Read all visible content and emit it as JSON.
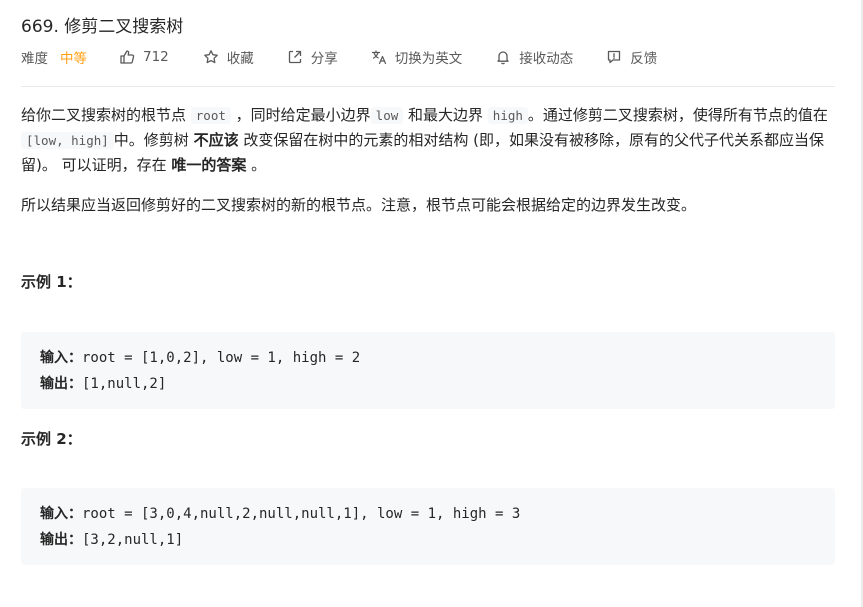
{
  "problem": {
    "title": "669. 修剪二叉搜索树",
    "difficulty_label": "难度",
    "difficulty": "中等",
    "likes": "712",
    "collect_label": "收藏",
    "share_label": "分享",
    "switch_lang_label": "切换为英文",
    "notify_label": "接收动态",
    "feedback_label": "反馈"
  },
  "description": {
    "p1": {
      "t1": "给你二叉搜索树的根节点 ",
      "c1": "root",
      "t2": " ，同时给定最小边界",
      "c2": "low",
      "t3": " 和最大边界 ",
      "c3": "high",
      "t4": "。通过修剪二叉搜索树，使得所有节点的值在",
      "c4": "[low, high]",
      "t5": "中。修剪树 ",
      "b1": "不应该",
      "t6": " 改变保留在树中的元素的相对结构 (即，如果没有被移除，原有的父代子代关系都应当保留)。 可以证明，存在 ",
      "b2": "唯一的答案",
      "t7": " 。"
    },
    "p2": "所以结果应当返回修剪好的二叉搜索树的新的根节点。注意，根节点可能会根据给定的边界发生改变。"
  },
  "examples": [
    {
      "title": "示例 1：",
      "input_label": "输入：",
      "input": "root = [1,0,2], low = 1, high = 2",
      "output_label": "输出：",
      "output": "[1,null,2]"
    },
    {
      "title": "示例 2：",
      "input_label": "输入：",
      "input": "root = [3,0,4,null,2,null,null,1], low = 1, high = 3",
      "output_label": "输出：",
      "output": "[3,2,null,1]"
    }
  ]
}
